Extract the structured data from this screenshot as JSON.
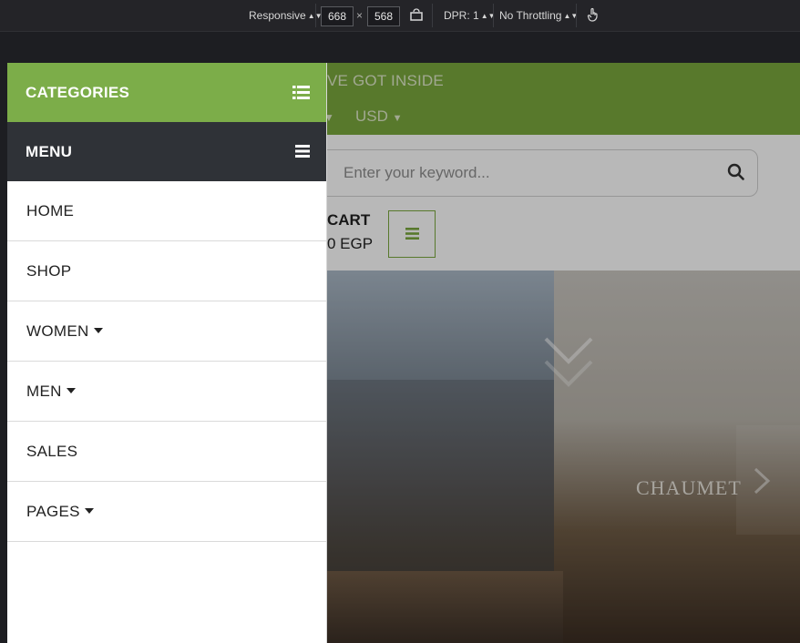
{
  "devtools": {
    "device": "Responsive",
    "width": "668",
    "times": "×",
    "height": "568",
    "dpr": "DPR: 1",
    "throttling": "No Throttling"
  },
  "site": {
    "promo_partial": "VE GOT INSIDE",
    "currency": "USD",
    "search_placeholder": "Enter your keyword...",
    "cart_title": "CART",
    "cart_amount": "0 EGP",
    "store_sign": "CHAUMET"
  },
  "drawer": {
    "categories_label": "CATEGORIES",
    "menu_label": "MENU",
    "items": [
      {
        "label": "HOME",
        "dropdown": false
      },
      {
        "label": "SHOP",
        "dropdown": false
      },
      {
        "label": "WOMEN",
        "dropdown": true
      },
      {
        "label": "MEN",
        "dropdown": true
      },
      {
        "label": "SALES",
        "dropdown": false
      },
      {
        "label": "PAGES",
        "dropdown": true
      }
    ]
  },
  "colors": {
    "green": "#7cad49",
    "dark": "#2f3237"
  }
}
